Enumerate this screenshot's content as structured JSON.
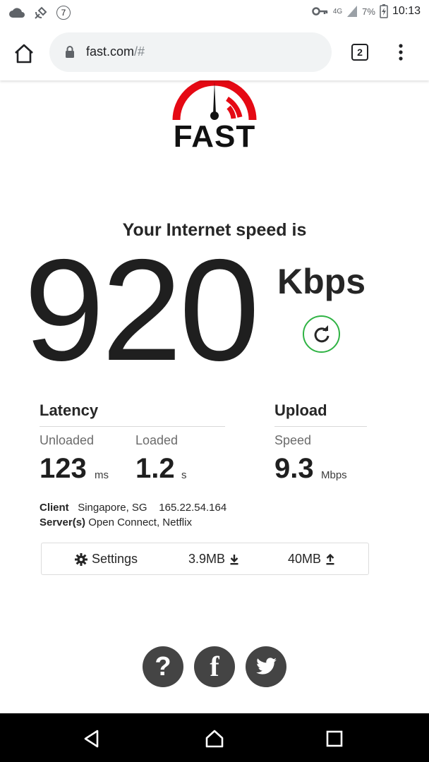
{
  "status_bar": {
    "badge_count": "7",
    "network": "4G",
    "battery_percent": "7%",
    "time": "10:13"
  },
  "browser": {
    "url_host": "fast.com",
    "url_suffix": "/#",
    "tab_count": "2"
  },
  "logo": {
    "text": "FAST",
    "brand_color": "#e50914"
  },
  "speed": {
    "heading": "Your Internet speed is",
    "value": "920",
    "units": "Kbps"
  },
  "latency": {
    "title": "Latency",
    "unloaded_label": "Unloaded",
    "unloaded_value": "123",
    "unloaded_unit": "ms",
    "loaded_label": "Loaded",
    "loaded_value": "1.2",
    "loaded_unit": "s"
  },
  "upload": {
    "title": "Upload",
    "speed_label": "Speed",
    "speed_value": "9.3",
    "speed_unit": "Mbps"
  },
  "client": {
    "label": "Client",
    "location": "Singapore, SG",
    "ip": "165.22.54.164"
  },
  "server": {
    "label": "Server(s)",
    "value": "Open Connect, Netflix"
  },
  "settings_bar": {
    "settings_label": "Settings",
    "download_size": "3.9MB",
    "upload_size": "40MB"
  },
  "colors": {
    "accent_green": "#2fb344",
    "social_bg": "#444444"
  }
}
